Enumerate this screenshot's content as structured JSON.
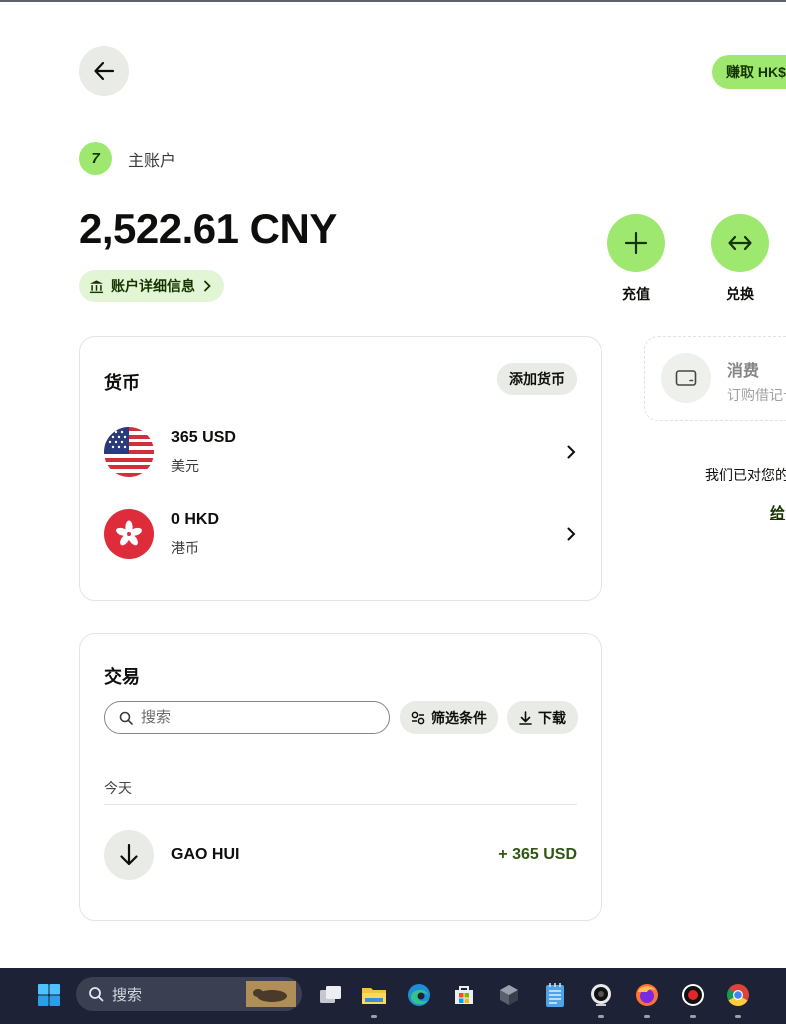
{
  "header": {
    "earn_label": "赚取 HK$"
  },
  "account": {
    "label": "主账户",
    "logo_text": "7",
    "balance": "2,522.61 CNY",
    "details_label": "账户详细信息"
  },
  "actions": [
    {
      "label": "充值",
      "icon": "plus-icon"
    },
    {
      "label": "兑换",
      "icon": "exchange-icon"
    }
  ],
  "currencies": {
    "title": "货币",
    "add_label": "添加货币",
    "items": [
      {
        "amount": "365 USD",
        "name": "美元",
        "flag": "us-flag"
      },
      {
        "amount": "0 HKD",
        "name": "港币",
        "flag": "hk-flag"
      }
    ]
  },
  "transactions": {
    "title": "交易",
    "search_placeholder": "搜索",
    "filter_label": "筛选条件",
    "download_label": "下载",
    "date_group": "今天",
    "items": [
      {
        "name": "GAO HUI",
        "amount": "+ 365 USD",
        "direction": "incoming"
      }
    ]
  },
  "spend": {
    "title": "消费",
    "subtitle": "订购借记卡"
  },
  "notice": {
    "text": "我们已对您的",
    "link": "给"
  },
  "taskbar": {
    "search_placeholder": "搜索"
  },
  "colors": {
    "accent": "#9fe870",
    "brand_dark": "#163300",
    "positive": "#2f5711"
  }
}
